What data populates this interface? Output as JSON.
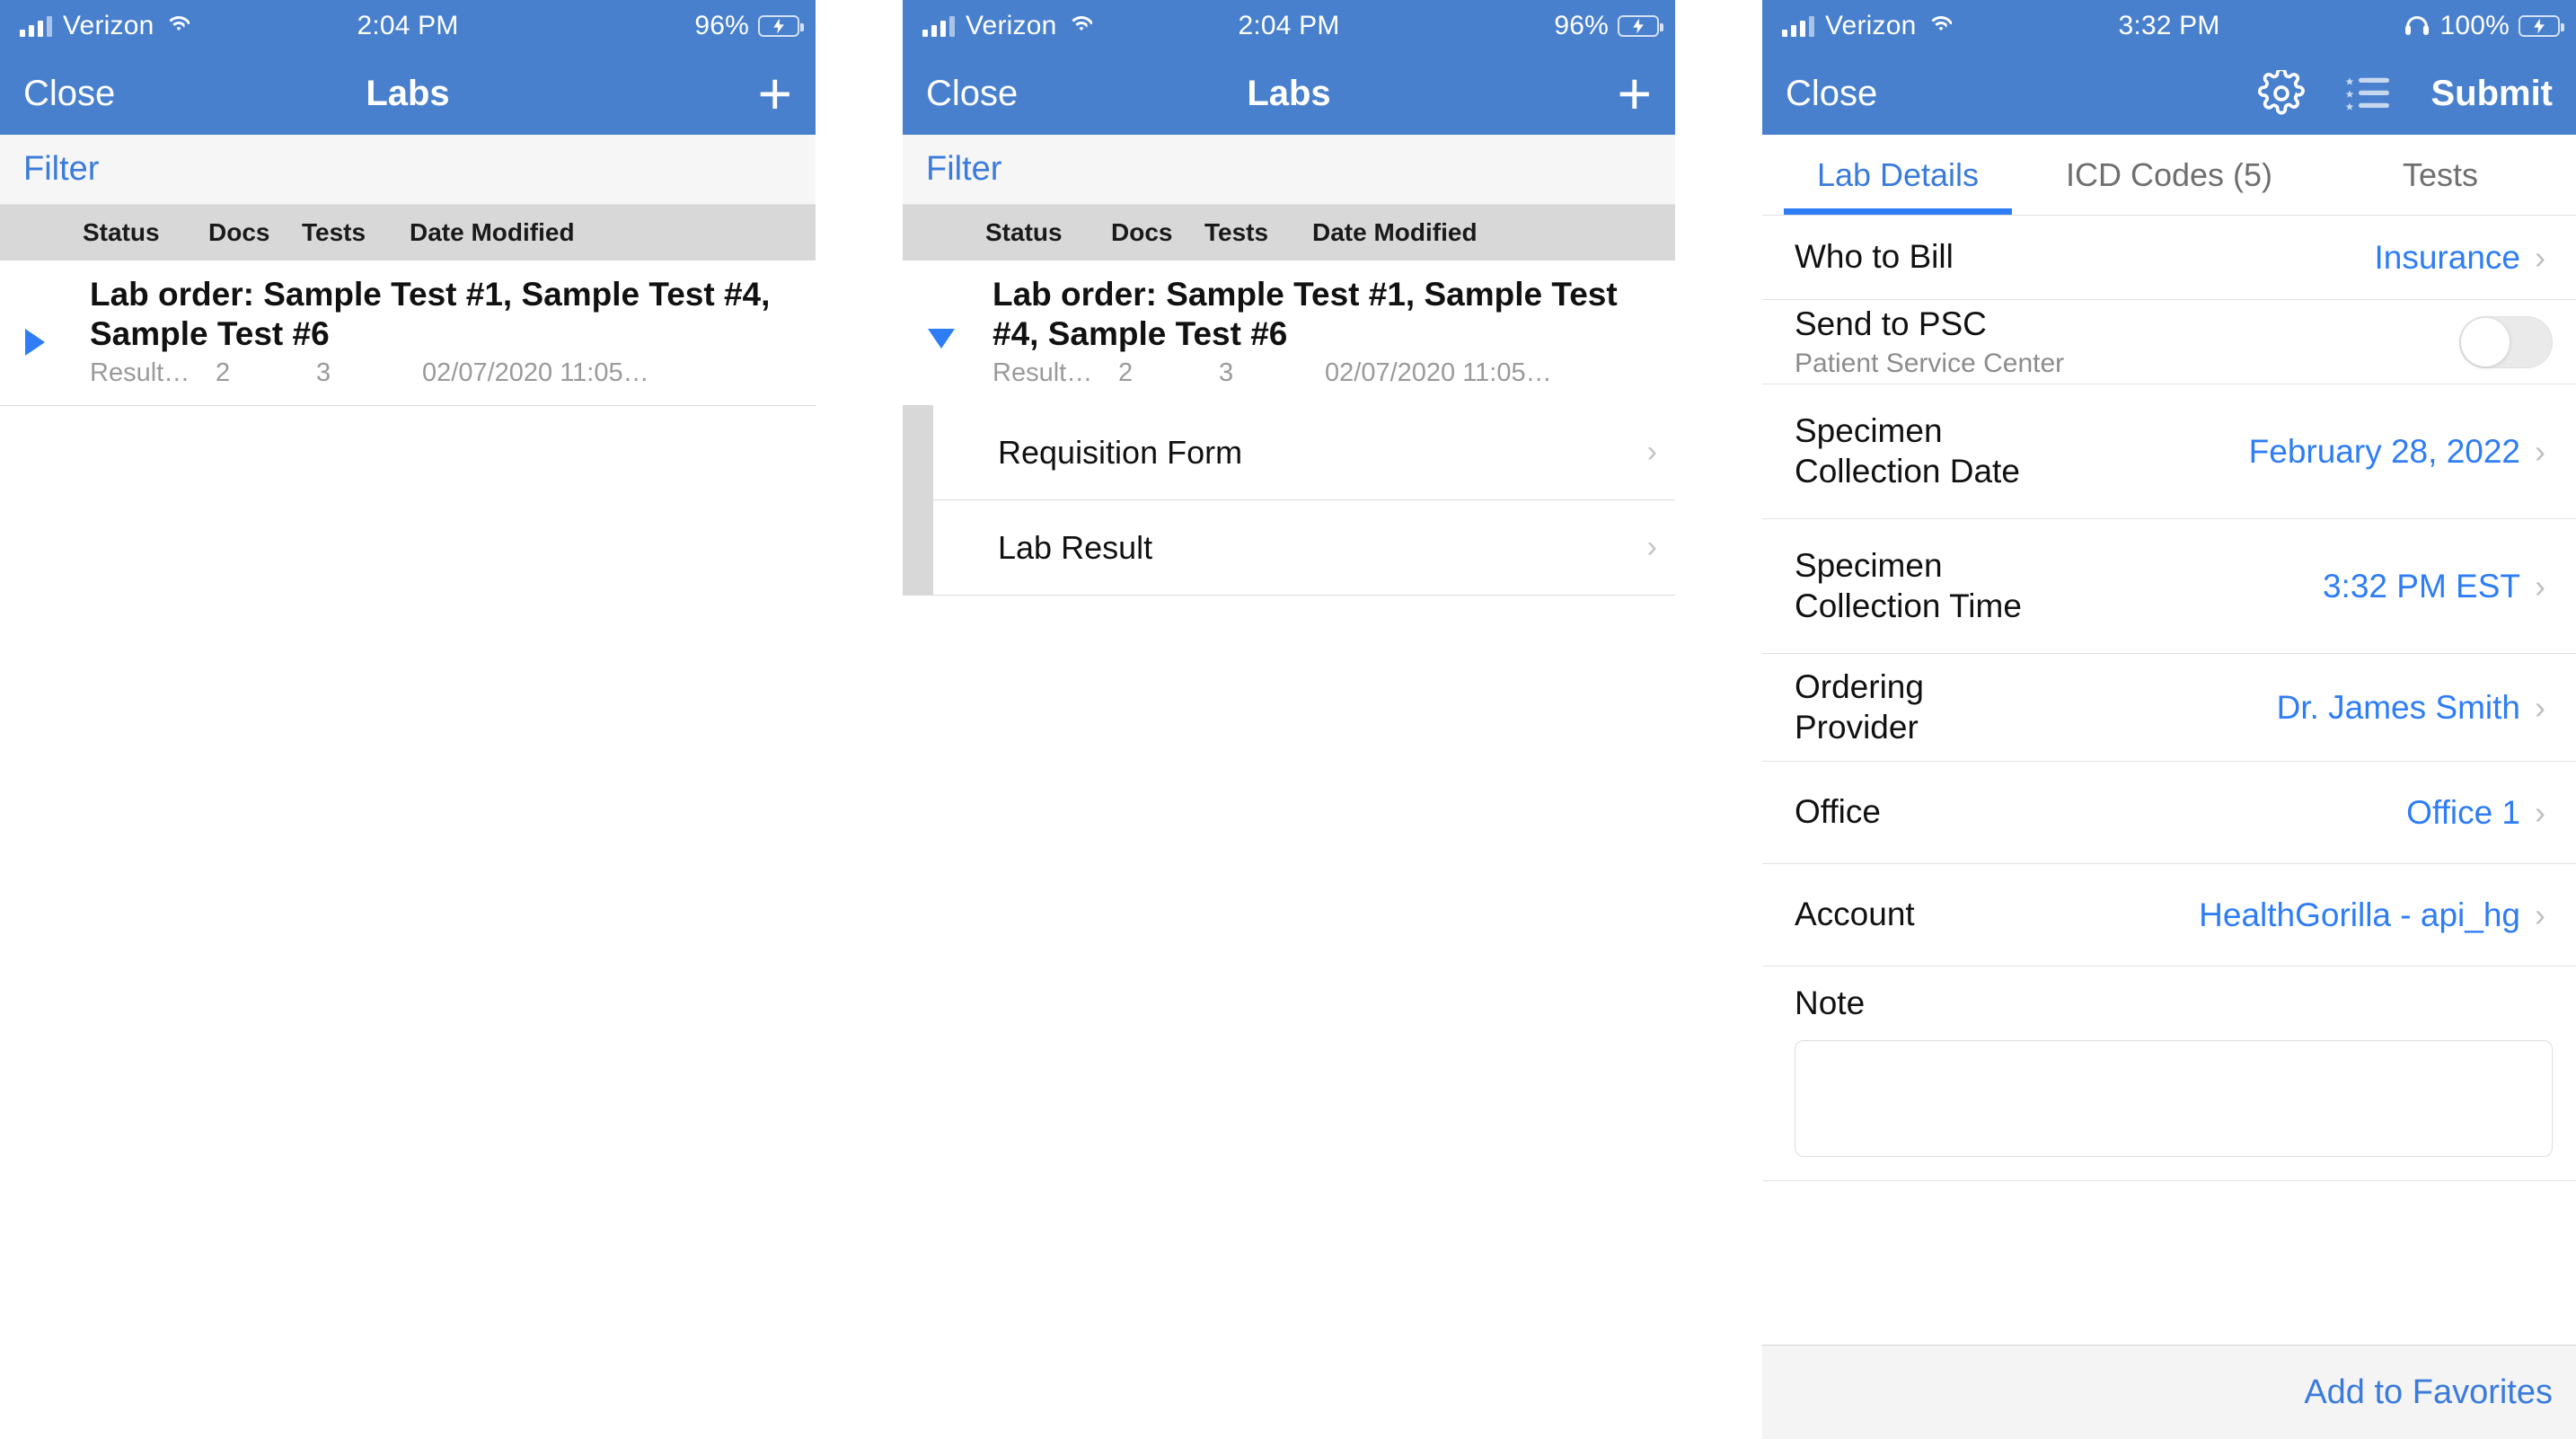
{
  "panels": [
    {
      "id": "labs-collapsed",
      "status_bar": {
        "carrier": "Verizon",
        "time": "2:04 PM",
        "battery_pct": "96%",
        "signal_icon": "cellular-bars-icon",
        "wifi_icon": "wifi-icon",
        "battery_icon": "battery-charging-icon"
      },
      "nav": {
        "left_label": "Close",
        "title": "Labs",
        "add_label": "+",
        "add_icon": "plus-icon"
      },
      "filter": {
        "label": "Filter"
      },
      "table": {
        "columns": [
          "Status",
          "Docs",
          "Tests",
          "Date Modified"
        ],
        "rows": [
          {
            "expanded": false,
            "caret_icon": "caret-right-icon",
            "title": "Lab order: Sample Test #1, Sample Test #4, Sample Test #6",
            "status": "Result…",
            "docs": "2",
            "tests": "3",
            "date_modified": "02/07/2020 11:05…"
          }
        ]
      }
    },
    {
      "id": "labs-expanded",
      "status_bar": {
        "carrier": "Verizon",
        "time": "2:04 PM",
        "battery_pct": "96%",
        "signal_icon": "cellular-bars-icon",
        "wifi_icon": "wifi-icon",
        "battery_icon": "battery-charging-icon"
      },
      "nav": {
        "left_label": "Close",
        "title": "Labs",
        "add_label": "+",
        "add_icon": "plus-icon"
      },
      "filter": {
        "label": "Filter"
      },
      "table": {
        "columns": [
          "Status",
          "Docs",
          "Tests",
          "Date Modified"
        ],
        "rows": [
          {
            "expanded": true,
            "caret_icon": "caret-down-icon",
            "title": "Lab order: Sample Test #1, Sample Test #4, Sample Test #6",
            "status": "Result…",
            "docs": "2",
            "tests": "3",
            "date_modified": "02/07/2020 11:05…"
          }
        ],
        "sub_items": [
          {
            "label": "Requisition Form",
            "chevron_icon": "chevron-right-icon"
          },
          {
            "label": "Lab Result",
            "chevron_icon": "chevron-right-icon"
          }
        ]
      }
    },
    {
      "id": "lab-details",
      "status_bar": {
        "carrier": "Verizon",
        "time": "3:32 PM",
        "battery_pct": "100%",
        "signal_icon": "cellular-bars-icon",
        "wifi_icon": "wifi-icon",
        "headphone_icon": "headphones-icon",
        "battery_icon": "battery-charging-icon"
      },
      "nav": {
        "left_label": "Close",
        "gear_icon": "gear-icon",
        "favorites_icon": "star-list-icon",
        "submit_label": "Submit"
      },
      "tabs": [
        {
          "label": "Lab Details",
          "active": true
        },
        {
          "label": "ICD Codes (5)",
          "active": false
        },
        {
          "label": "Tests",
          "active": false
        }
      ],
      "form_rows": [
        {
          "label": "Who to Bill",
          "sublabel": "",
          "value": "Insurance",
          "control": "chevron",
          "chevron_icon": "chevron-right-icon"
        },
        {
          "label": "Send to PSC",
          "sublabel": "Patient Service Center",
          "value": "",
          "control": "toggle",
          "toggle_on": false
        },
        {
          "label": "Specimen Collection Date",
          "sublabel": "",
          "value": "February 28, 2022",
          "control": "chevron",
          "chevron_icon": "chevron-right-icon"
        },
        {
          "label": "Specimen Collection Time",
          "sublabel": "",
          "value": "3:32 PM EST",
          "control": "chevron",
          "chevron_icon": "chevron-right-icon"
        },
        {
          "label": "Ordering Provider",
          "sublabel": "",
          "value": "Dr. James Smith",
          "control": "chevron",
          "chevron_icon": "chevron-right-icon"
        },
        {
          "label": "Office",
          "sublabel": "",
          "value": "Office 1",
          "control": "chevron",
          "chevron_icon": "chevron-right-icon"
        },
        {
          "label": "Account",
          "sublabel": "",
          "value": "HealthGorilla - api_hg",
          "control": "chevron",
          "chevron_icon": "chevron-right-icon"
        }
      ],
      "note": {
        "label": "Note",
        "value": "",
        "placeholder": ""
      },
      "footer": {
        "favorites_label": "Add to Favorites"
      }
    }
  ],
  "colors": {
    "header_blue": "#4880CE",
    "link_blue": "#2E7DF6",
    "filter_blue": "#3A7BDB",
    "table_header_gray": "#D8D8D8",
    "battery_green": "#6BD35F"
  }
}
